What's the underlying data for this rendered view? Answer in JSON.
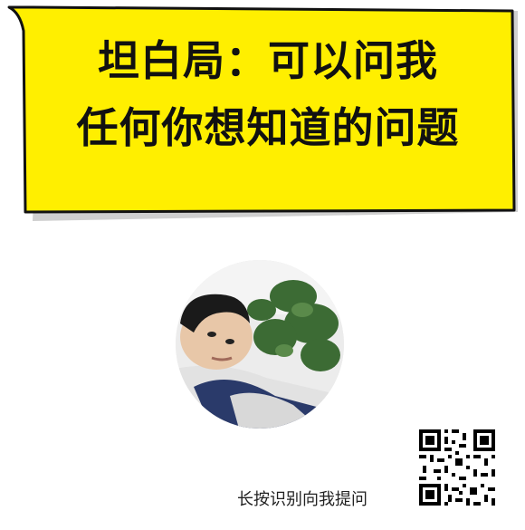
{
  "banner": {
    "line1": "坦白局：可以问我",
    "line2": "任何你想知道的问题",
    "background_color": "#ffef00",
    "border_color": "#111111"
  },
  "avatar": {
    "description_icon": "profile-photo"
  },
  "qr": {
    "icon": "qr-code-icon"
  },
  "footer": {
    "prompt": "长按识别向我提问"
  }
}
